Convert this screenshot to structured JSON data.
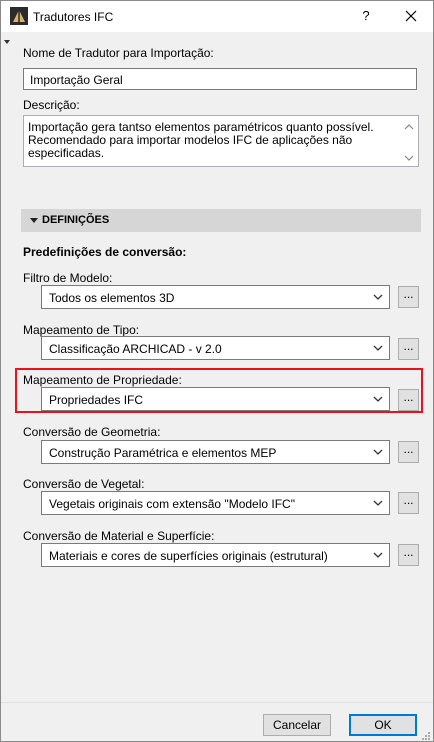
{
  "window": {
    "title": "Tradutores IFC",
    "help_label": "?"
  },
  "translator_name": {
    "label": "Nome de Tradutor para Importação:",
    "value": "Importação Geral"
  },
  "description": {
    "label": "Descrição:",
    "text": "Importação gera tantso elementos paramétricos quanto possível. Recomendado para importar modelos IFC de aplicações não especificadas."
  },
  "section": {
    "title": "DEFINIÇÕES",
    "subtitle": "Predefinições de conversão:"
  },
  "settings": [
    {
      "label": "Filtro de Modelo:",
      "value": "Todos os elementos 3D",
      "button": "..."
    },
    {
      "label": "Mapeamento de Tipo:",
      "value": "Classificação ARCHICAD - v 2.0",
      "button": "..."
    },
    {
      "label": "Mapeamento de Propriedade:",
      "value": "Propriedades IFC",
      "button": "..."
    },
    {
      "label": "Conversão de Geometria:",
      "value": "Construção Paramétrica e elementos MEP",
      "button": "..."
    },
    {
      "label": "Conversão de Vegetal:",
      "value": "Vegetais originais com extensão \"Modelo IFC\"",
      "button": "..."
    },
    {
      "label": "Conversão de Material e Superfície:",
      "value": "Materiais e cores de superfícies originais (estrutural)",
      "button": "..."
    }
  ],
  "footer": {
    "cancel_label": "Cancelar",
    "ok_label": "OK"
  },
  "colors": {
    "highlight": "#e8121a",
    "section_bg": "#d6d6d6",
    "ok_border": "#0078d7"
  }
}
